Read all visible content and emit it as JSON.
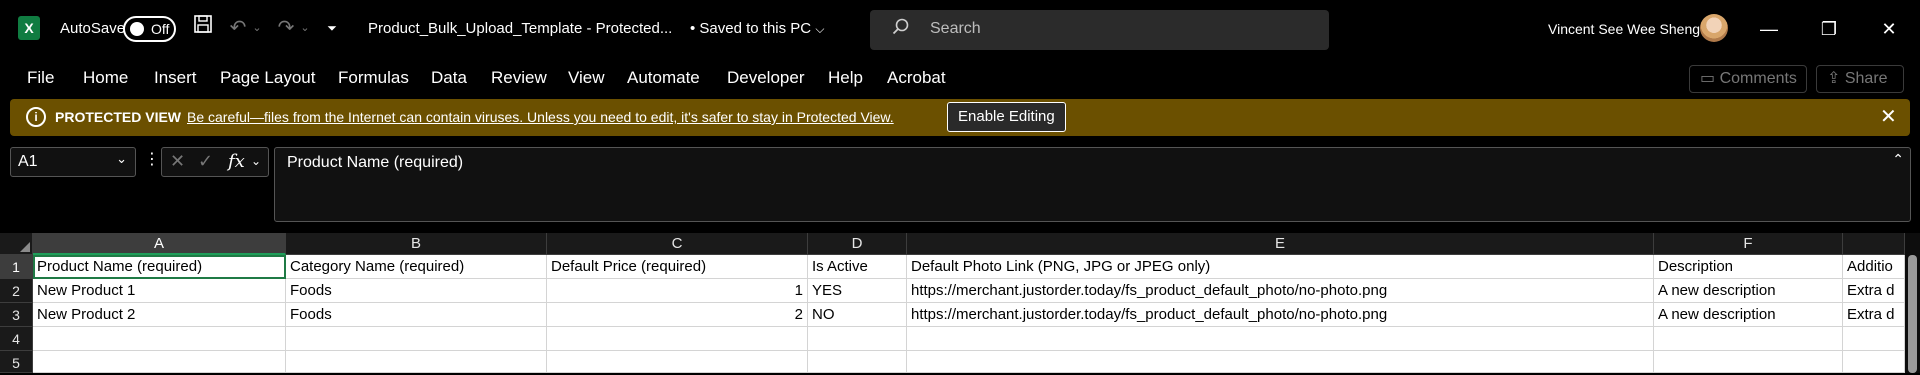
{
  "titlebar": {
    "app_logo": "X",
    "autosave_label": "AutoSave",
    "autosave_state": "Off",
    "file_title": "Product_Bulk_Upload_Template  -  Protected...",
    "saved_status": "• Saved to this PC",
    "search_placeholder": "Search",
    "user_name": "Vincent See Wee Sheng"
  },
  "ribbon": {
    "tabs": [
      "File",
      "Home",
      "Insert",
      "Page Layout",
      "Formulas",
      "Data",
      "Review",
      "View",
      "Automate",
      "Developer",
      "Help",
      "Acrobat"
    ],
    "comments_label": "Comments",
    "share_label": "Share"
  },
  "protected_view": {
    "title": "PROTECTED VIEW",
    "message": "Be careful—files from the Internet can contain viruses. Unless you need to edit, it's safer to stay in Protected View.",
    "enable_label": "Enable Editing"
  },
  "formula_bar": {
    "name_box": "A1",
    "fx_label": "fx",
    "formula": "Product Name (required)"
  },
  "grid": {
    "columns": [
      "A",
      "B",
      "C",
      "D",
      "E",
      "F",
      ""
    ],
    "rows": [
      {
        "num": "1",
        "cells": [
          "Product Name (required)",
          "Category Name (required)",
          "Default Price (required)",
          "Is Active",
          "Default Photo Link (PNG, JPG or JPEG only)",
          "Description",
          "Additio"
        ]
      },
      {
        "num": "2",
        "cells": [
          "New Product 1",
          "Foods",
          "1",
          "YES",
          "https://merchant.justorder.today/fs_product_default_photo/no-photo.png",
          "A new description",
          "Extra d"
        ]
      },
      {
        "num": "3",
        "cells": [
          "New Product 2",
          "Foods",
          "2",
          "NO",
          "https://merchant.justorder.today/fs_product_default_photo/no-photo.png",
          "A new description",
          "Extra d"
        ]
      },
      {
        "num": "4",
        "cells": [
          "",
          "",
          "",
          "",
          "",
          "",
          ""
        ]
      },
      {
        "num": "5",
        "cells": [
          "",
          "",
          "",
          "",
          "",
          "",
          ""
        ]
      }
    ]
  },
  "colors": {
    "protected_bar": "#6b5000",
    "selection_green": "#1f7a45",
    "excel_green": "#107c41"
  }
}
